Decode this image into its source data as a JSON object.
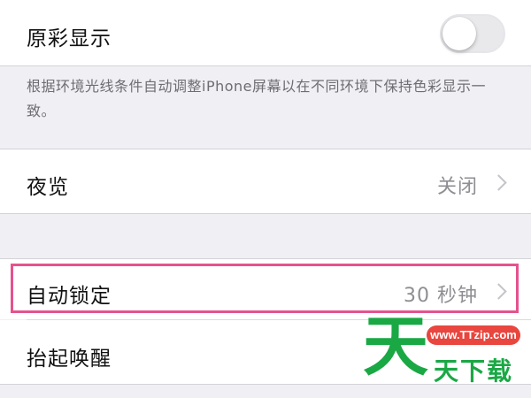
{
  "display": {
    "true_tone": {
      "label": "原彩显示",
      "enabled": false,
      "footer": "根据环境光线条件自动调整iPhone屏幕以在不同环境下保持色彩显示一致。"
    },
    "night_shift": {
      "label": "夜览",
      "value": "关闭",
      "icon": "chevron-right-icon"
    },
    "auto_lock": {
      "label": "自动锁定",
      "value": "30 秒钟",
      "icon": "chevron-right-icon",
      "highlighted": true
    },
    "raise_to_wake": {
      "label": "抬起唤醒"
    }
  },
  "colors": {
    "background": "#efeff4",
    "cell": "#ffffff",
    "secondary_text": "#8e8e93",
    "highlight_border": "#e4538d",
    "watermark_green": "#1aa845",
    "watermark_red": "#e8463e"
  },
  "watermark": {
    "big_char": "天",
    "url": "www.TTzip.com",
    "name": "天下载"
  }
}
